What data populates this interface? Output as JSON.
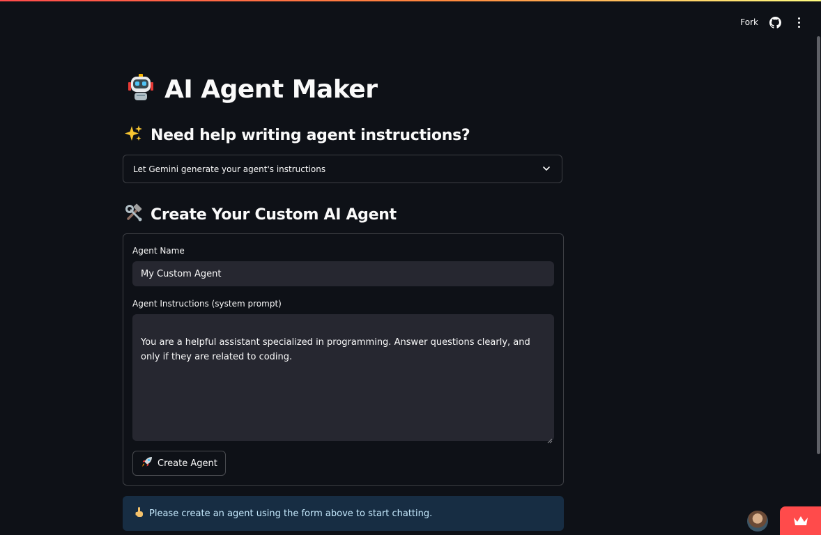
{
  "header": {
    "fork_label": "Fork",
    "github_icon": "github-icon",
    "menu_icon": "vertical-dots-icon"
  },
  "page": {
    "title": "AI Agent Maker",
    "title_icon": "robot-emoji"
  },
  "helper_section": {
    "heading": "Need help writing agent instructions?",
    "heading_icon": "sparkles-emoji",
    "expander_label": "Let Gemini generate your agent's instructions",
    "expander_icon": "chevron-down-icon"
  },
  "create_section": {
    "heading": "Create Your Custom AI Agent",
    "heading_icon": "hammer-wrench-emoji",
    "agent_name_label": "Agent Name",
    "agent_name_value": "My Custom Agent",
    "instructions_label": "Agent Instructions (system prompt)",
    "instructions_value": "You are a helpful assistant specialized in programming. Answer questions clearly, and only if they are related to coding.",
    "create_button_label": "Create Agent",
    "create_button_icon": "rocket-emoji"
  },
  "info": {
    "message": "Please create an agent using the form above to start chatting.",
    "icon": "pointing-up-emoji"
  },
  "colors": {
    "background": "#0e1117",
    "input_bg": "#262730",
    "info_bg": "#172d43",
    "info_text": "#c7ebff",
    "accent": "#ff4b4b"
  }
}
